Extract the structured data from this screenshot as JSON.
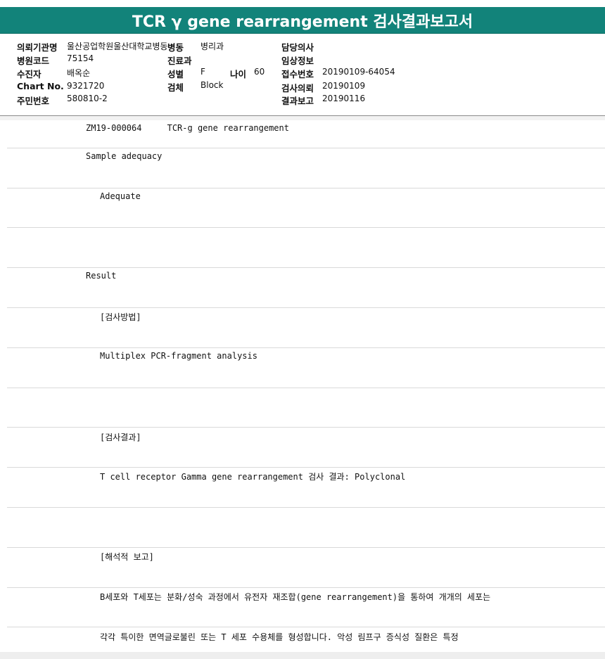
{
  "title": "TCR γ gene rearrangement 검사결과보고서",
  "info": {
    "institution_label": "의뢰기관명",
    "institution_value": "울산공업학원울산대학교병동",
    "ward_label": "병동",
    "ward_value": "병리과",
    "doctor_label": "담당의사",
    "doctor_value": "",
    "hospital_code_label": "병원코드",
    "hospital_code_value": "75154",
    "department_label": "진료과",
    "department_value": "",
    "clinical_label": "임상정보",
    "clinical_value": "",
    "patient_label": "수진자",
    "patient_value": "배옥순",
    "sex_label": "성별",
    "sex_value": "F",
    "age_label": "나이",
    "age_value": "60",
    "receipt_label": "접수번호",
    "receipt_value": "20190109-64054",
    "chart_label": "Chart No.",
    "chart_value": "9321720",
    "specimen_label": "검체",
    "specimen_value": "Block",
    "request_label": "검사의뢰",
    "request_value": "20190109",
    "id_label": "주민번호",
    "id_value": "580810-2",
    "report_label": "결과보고",
    "report_value": "20190116"
  },
  "report_lines": [
    {
      "indent": 0,
      "text": "ZM19-000064     TCR-g gene rearrangement"
    },
    {
      "indent": 0,
      "text": "Sample adequacy"
    },
    {
      "indent": 1,
      "text": "Adequate"
    },
    {
      "indent": 0,
      "text": ""
    },
    {
      "indent": 0,
      "text": "Result"
    },
    {
      "indent": 1,
      "text": "[검사방법]"
    },
    {
      "indent": 1,
      "text": "Multiplex PCR-fragment analysis"
    },
    {
      "indent": 0,
      "text": ""
    },
    {
      "indent": 1,
      "text": "[검사결과]"
    },
    {
      "indent": 1,
      "text": "T cell receptor Gamma gene rearrangement 검사 결과: Polyclonal"
    },
    {
      "indent": 0,
      "text": ""
    },
    {
      "indent": 1,
      "text": "[해석적 보고]"
    },
    {
      "indent": 1,
      "text": "B세포와 T세포는 분화/성숙 과정에서 유전자 재조합(gene rearrangement)을 통하여 개개의 세포는"
    },
    {
      "indent": 1,
      "text": "각각 특이한 면역글로불린 또는 T 세포 수용체를 형성합니다. 악성 림프구 증식성 질환은 특정"
    }
  ]
}
